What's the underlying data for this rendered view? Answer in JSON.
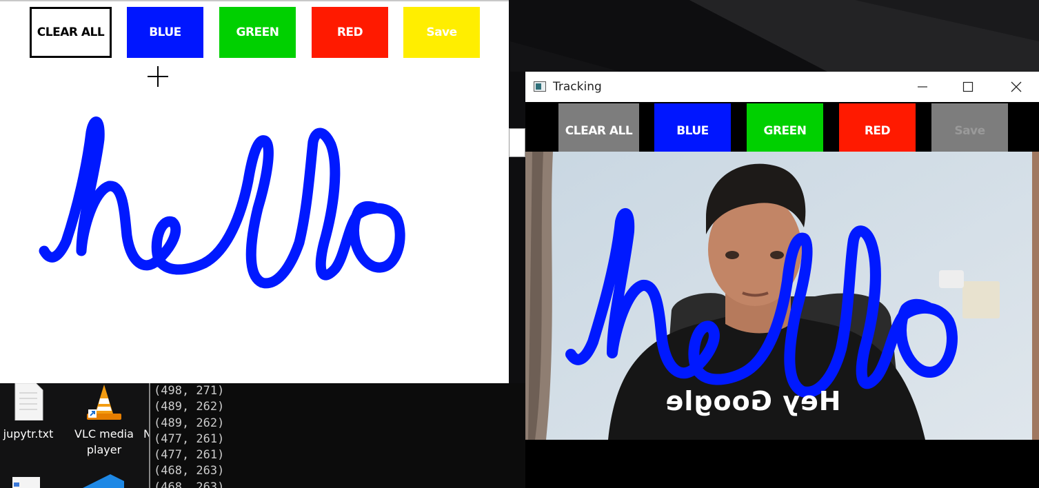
{
  "paint_window": {
    "buttons": [
      {
        "label": "CLEAR ALL",
        "bg": "#ffffff",
        "fg": "#000000"
      },
      {
        "label": "BLUE",
        "bg": "#0016ff",
        "fg": "#ffffff"
      },
      {
        "label": "GREEN",
        "bg": "#00d000",
        "fg": "#ffffff"
      },
      {
        "label": "RED",
        "bg": "#ff1a00",
        "fg": "#ffffff"
      },
      {
        "label": "Save",
        "bg": "#ffee00",
        "fg": "#ffffff"
      }
    ],
    "ink_color": "#0019ff",
    "cursor_icon": "crosshair-icon"
  },
  "desktop": {
    "icons": [
      {
        "label": "jupytr.txt",
        "icon": "text-file-icon"
      },
      {
        "label": "VLC media player",
        "icon": "vlc-cone-icon"
      }
    ],
    "partial_icon_letter": "N"
  },
  "console": {
    "lines": [
      "(498, 271)",
      "(489, 262)",
      "(489, 262)",
      "(477, 261)",
      "(477, 261)",
      "(468, 263)",
      "(468, 263)"
    ]
  },
  "tracking_window": {
    "title": "Tracking",
    "controls": {
      "minimize": "minimize-icon",
      "maximize": "maximize-icon",
      "close": "close-icon"
    },
    "buttons": [
      {
        "label": "CLEAR ALL",
        "bg": "#7d7d7d",
        "fg": "#ffffff"
      },
      {
        "label": "BLUE",
        "bg": "#0016ff",
        "fg": "#ffffff"
      },
      {
        "label": "GREEN",
        "bg": "#00d000",
        "fg": "#ffffff"
      },
      {
        "label": "RED",
        "bg": "#ff1a00",
        "fg": "#ffffff"
      },
      {
        "label": "Save",
        "bg": "#7d7d7d",
        "fg": "#9a9a9a"
      }
    ],
    "shirt_text": "Hey Google",
    "ink_color": "#0019ff"
  }
}
